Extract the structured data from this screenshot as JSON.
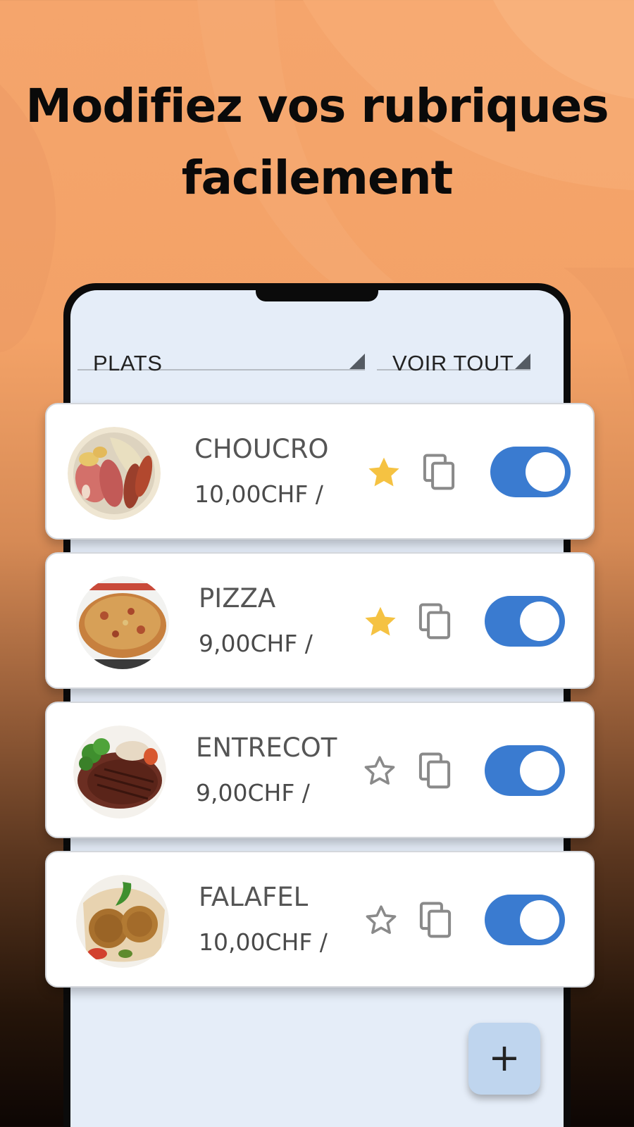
{
  "headline": {
    "line1": "Modifiez vos rubriques",
    "line2": "facilement"
  },
  "filters": {
    "category": "PLATS",
    "visibility": "VOIR TOUT"
  },
  "items": [
    {
      "name": "CHOUCRO",
      "price": "10,00CHF /",
      "favorite": true,
      "enabled": true,
      "image": "choucroute-plate"
    },
    {
      "name": "PIZZA",
      "price": "9,00CHF /",
      "favorite": true,
      "enabled": true,
      "image": "pizza-plate"
    },
    {
      "name": "ENTRECOT",
      "price": "9,00CHF /",
      "favorite": false,
      "enabled": true,
      "image": "steak-plate"
    },
    {
      "name": "FALAFEL",
      "price": "10,00CHF /",
      "favorite": false,
      "enabled": true,
      "image": "falafel-plate"
    }
  ],
  "fab": {
    "label": "+"
  },
  "colors": {
    "accent": "#3a7bd0",
    "star_active": "#f5c242",
    "screen_bg": "#e5edf8",
    "fab_bg": "#bfd5ee"
  }
}
